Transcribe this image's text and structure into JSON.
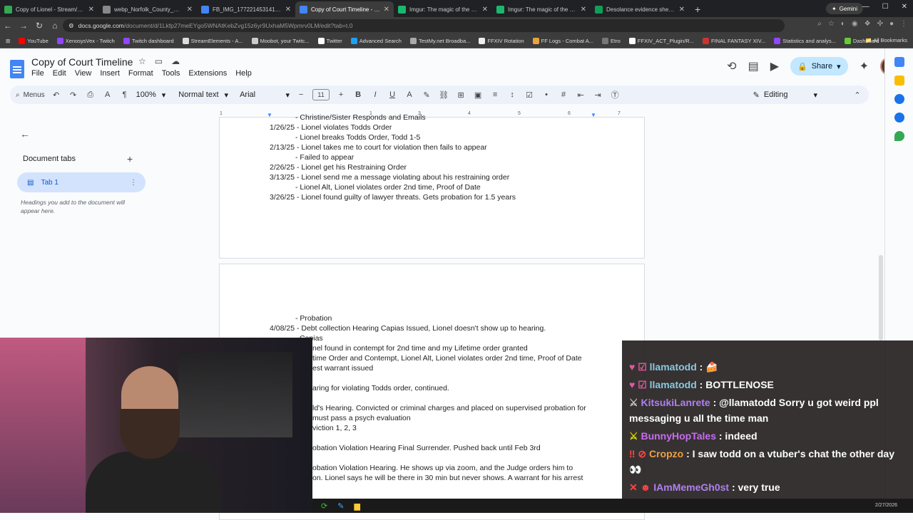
{
  "browser": {
    "tabs": [
      {
        "title": "Copy of Lionel - Stream/Youtub",
        "color": "#34a853"
      },
      {
        "title": "webp_Norfolk_County_Correcti",
        "color": "#888888"
      },
      {
        "title": "FB_IMG_1772214531415.jpg (9",
        "color": "#4285f4"
      },
      {
        "title": "Copy of Court Timeline - Goog",
        "color": "#4285f4",
        "active": true
      },
      {
        "title": "Imgur: The magic of the Intern",
        "color": "#1bb76e"
      },
      {
        "title": "Imgur: The magic of the Intern",
        "color": "#1bb76e"
      },
      {
        "title": "Desolance evidence sheet - Go",
        "color": "#0f9d58"
      }
    ],
    "new_tab": "+",
    "gemini": "Gemini",
    "url_host": "docs.google.com",
    "url_path": "/document/d/1Lkfp27meEYgo5WNAtKebZvg15z6yr9UxhaM5Wpmrv0LM/edit?tab=t.0",
    "bookmarks": [
      "YouTube",
      "XenosysVex - Twitch",
      "Twitch dashboard",
      "StreamElements - A...",
      "Moobot, your Twitc...",
      "Twitter",
      "Advanced Search",
      "TestMy.net Broadba...",
      "FFXIV Rotation",
      "FF Logs - Combat A...",
      "Etro",
      "FFXIV_ACT_Plugin/R...",
      "FINAL FANTASY XIV...",
      "Statistics and analys...",
      "Dashboard"
    ],
    "all_bookmarks": "All Bookmarks"
  },
  "docs": {
    "title": "Copy of Court Timeline",
    "menus": [
      "File",
      "Edit",
      "View",
      "Insert",
      "Format",
      "Tools",
      "Extensions",
      "Help"
    ],
    "share": "Share",
    "toolbar": {
      "menus_label": "Menus",
      "zoom": "100%",
      "style": "Normal text",
      "font": "Arial",
      "font_size": "11",
      "mode": "Editing"
    },
    "sidebar": {
      "heading": "Document tabs",
      "tab": "Tab 1",
      "hint": "Headings you add to the document will appear here."
    },
    "ruler": [
      "1",
      "1",
      "2",
      "3",
      "4",
      "5",
      "6",
      "7"
    ],
    "page1_lines": [
      "- Christine/Sister Responds and Emails",
      "1/26/25 - Lionel violates Todds Order",
      "- Lionel breaks Todds Order, Todd 1-5",
      "2/13/25 - Lionel takes me to court for violation then fails to appear",
      "- Failed to appear",
      "2/26/25 - Lionel get his Restraining Order",
      "3/13/25 - Lionel send me a message violating about his restraining order",
      "- Lionel Alt, Lionel violates order 2nd time, Proof of Date",
      "3/26/25 - Lionel found guilty of lawyer threats. Gets probation for 1.5 years"
    ],
    "page2_lines": [
      "- Probation",
      "4/08/25 - Debt collection Hearing Capias Issued, Lionel doesn't show up to hearing.",
      "Capias",
      "nel found in contempt for 2nd time and my Lifetime order granted",
      "time Order and Contempt, Lionel Alt, Lionel violates order 2nd time, Proof of Date",
      "est warrant issued",
      "aring for violating Todds order, continued.",
      "ld's Hearing. Convicted or criminal charges and placed on supervised probation for",
      "must pass a psych evaluation",
      "viction 1, 2, 3",
      "obation Violation Hearing Final Surrender. Pushed back until Feb 3rd",
      "obation Violation Hearing. He shows up via zoom, and the Judge orders him to",
      "on. Lionel says he will be there in 30 min but never shows. A warrant for his arrest"
    ]
  },
  "chat": [
    {
      "user": "llamatodd",
      "text": ": 🍰"
    },
    {
      "user": "llamatodd",
      "text": ": BOTTLENOSE"
    },
    {
      "user": "KitsukiLanrete",
      "text": ": @llamatodd Sorry u got weird ppl messaging u all the time man"
    },
    {
      "user": "BunnyHopTales",
      "text": ": indeed"
    },
    {
      "user": "Cropzo",
      "text": ": I saw todd on a vtuber's chat the other day 👀"
    },
    {
      "user": "IAmMemeGh0st",
      "text": ": very true"
    }
  ],
  "clock": "2/27/2026"
}
